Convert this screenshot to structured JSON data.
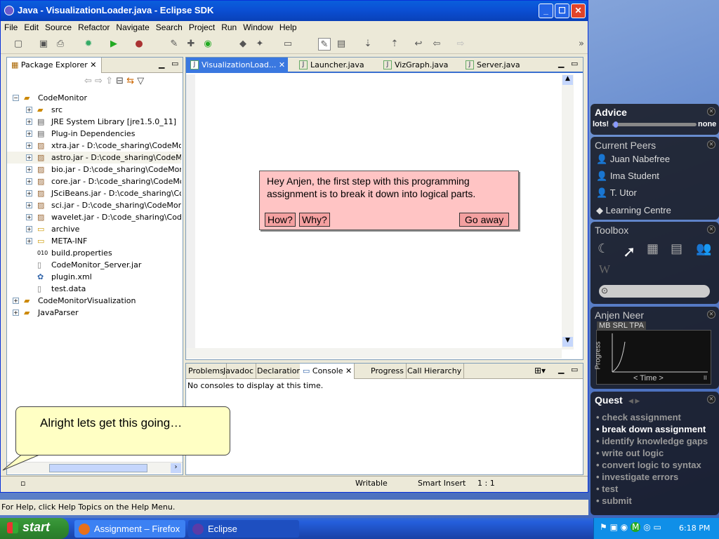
{
  "window": {
    "title": "Java - VisualizationLoader.java - Eclipse SDK"
  },
  "menu": [
    "File",
    "Edit",
    "Source",
    "Refactor",
    "Navigate",
    "Search",
    "Project",
    "Run",
    "Window",
    "Help"
  ],
  "package_explorer": {
    "title": "Package Explorer",
    "items": [
      {
        "label": "CodeMonitor"
      },
      {
        "label": "src"
      },
      {
        "label": "JRE System Library [jre1.5.0_11]"
      },
      {
        "label": "Plug-in Dependencies"
      },
      {
        "label": "xtra.jar - D:\\code_sharing\\CodeMonitor"
      },
      {
        "label": "astro.jar - D:\\code_sharing\\CodeMonitor"
      },
      {
        "label": "bio.jar - D:\\code_sharing\\CodeMonitor"
      },
      {
        "label": "core.jar - D:\\code_sharing\\CodeMonitor"
      },
      {
        "label": "JSciBeans.jar - D:\\code_sharing\\CodeMonitor"
      },
      {
        "label": "sci.jar - D:\\code_sharing\\CodeMonitor"
      },
      {
        "label": "wavelet.jar - D:\\code_sharing\\CodeMonitor"
      },
      {
        "label": "archive"
      },
      {
        "label": "META-INF"
      },
      {
        "label": "build.properties"
      },
      {
        "label": "CodeMonitor_Server.jar"
      },
      {
        "label": "plugin.xml"
      },
      {
        "label": "test.data"
      },
      {
        "label": "CodeMonitorVisualization"
      },
      {
        "label": "JavaParser"
      }
    ]
  },
  "editor": {
    "tabs": [
      "VisualizationLoad...",
      "Launcher.java",
      "VizGraph.java",
      "Server.java"
    ]
  },
  "hint": {
    "text": "Hey Anjen, the first step with this programming assignment is to break it down into logical parts.",
    "how": "How?",
    "why": "Why?",
    "go_away": "Go away"
  },
  "console": {
    "tabs": [
      "Problems",
      "Javadoc",
      "Declaration",
      "Console",
      "Progress",
      "Call Hierarchy"
    ],
    "message": "No consoles to display at this time."
  },
  "status": {
    "writable": "Writable",
    "insert": "Smart Insert",
    "position": "1 : 1"
  },
  "helpline": "For Help, click Help Topics on the Help Menu.",
  "bubble": "Alright lets get this going…",
  "advice": {
    "title": "Advice",
    "min_label": "lots!",
    "max_label": "none",
    "level": 0.02
  },
  "peers": {
    "title": "Current Peers",
    "names": [
      "Juan Nabefree",
      "Ima Student",
      "T. Utor",
      "Learning Centre"
    ]
  },
  "toolbox": {
    "title": "Toolbox"
  },
  "student": {
    "title": "Anjen Neer",
    "tabs": "MB SRL TPA",
    "ylabel": "Progress",
    "xlabel": "< Time >"
  },
  "quest": {
    "title": "Quest",
    "active_index": 1,
    "items": [
      "• check assignment",
      "• break down assignment",
      "• identify knowledge gaps",
      "• write out logic",
      "• convert logic to syntax",
      "• investigate errors",
      "• test",
      "• submit"
    ]
  },
  "taskbar": {
    "start": "start",
    "firefox": "Assignment – Firefox",
    "eclipse": "Eclipse",
    "time": "6:18 PM"
  }
}
